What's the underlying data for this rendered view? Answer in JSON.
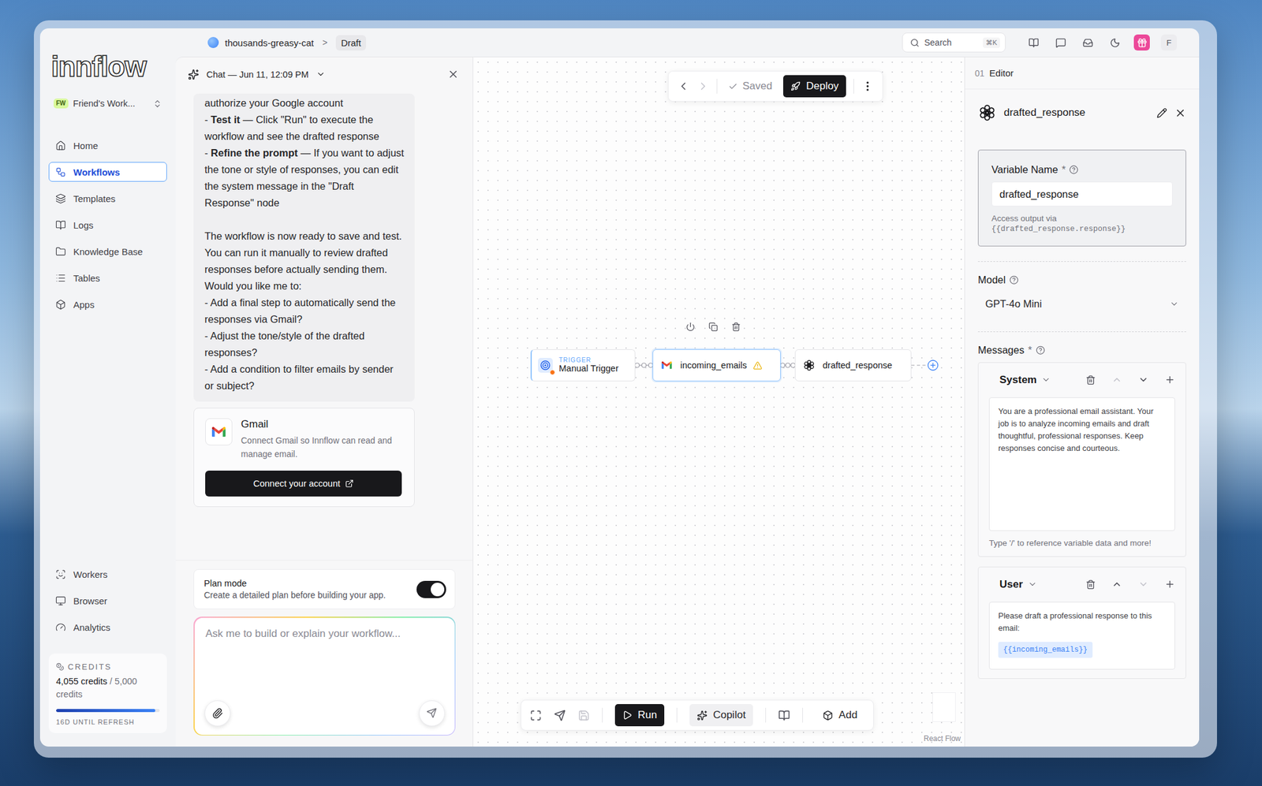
{
  "breadcrumb": {
    "project": "thousands-greasy-cat",
    "separator": ">",
    "page": "Draft"
  },
  "topbar": {
    "search": {
      "placeholder": "Search",
      "shortcut": "⌘K"
    },
    "avatar": "F"
  },
  "sidebar": {
    "logo": "innflow",
    "workspace": {
      "badge": "FW",
      "name": "Friend's Work..."
    },
    "items": [
      {
        "label": "Home",
        "selected": false
      },
      {
        "label": "Workflows",
        "selected": true
      },
      {
        "label": "Templates",
        "selected": false
      },
      {
        "label": "Logs",
        "selected": false
      },
      {
        "label": "Knowledge Base",
        "selected": false
      },
      {
        "label": "Tables",
        "selected": false
      },
      {
        "label": "Apps",
        "selected": false
      }
    ],
    "bottom_items": [
      {
        "label": "Workers",
        "selected": false
      },
      {
        "label": "Browser",
        "selected": false
      },
      {
        "label": "Analytics",
        "selected": false
      }
    ],
    "credits": {
      "title": "CREDITS",
      "amount": "4,055 credits",
      "total": "/ 5,000 credits",
      "level": 0.96,
      "refresh": "16D UNTIL REFRESH"
    }
  },
  "chat": {
    "title": "Chat — Jun 11, 12:09 PM",
    "paragraphs": [
      [
        {
          "prefix": "",
          "bold": "",
          "text": "authorize your Google account"
        },
        {
          "prefix": "- ",
          "bold": "Test it",
          "text": " — Click \"Run\" to execute the workflow and see the drafted response"
        },
        {
          "prefix": "- ",
          "bold": "Refine the prompt",
          "text": " — If you want to adjust the tone or style of responses, you can edit the system message in the \"Draft Response\" node"
        }
      ],
      [
        {
          "prefix": "",
          "bold": "",
          "text": "The workflow is now ready to save and test. You can run it manually to review drafted responses before actually sending them. Would you like me to:"
        },
        {
          "prefix": "- ",
          "bold": "",
          "text": "Add a final step to automatically send the responses via Gmail?"
        },
        {
          "prefix": "- ",
          "bold": "",
          "text": "Adjust the tone/style of the drafted responses?"
        },
        {
          "prefix": "- ",
          "bold": "",
          "text": "Add a condition to filter emails by sender or subject?"
        }
      ]
    ],
    "connect_card": {
      "title": "Gmail",
      "description": "Connect Gmail so Innflow can read and manage email.",
      "button": "Connect your account"
    },
    "plan_mode": {
      "title": "Plan mode",
      "description": "Create a detailed plan before building your app.",
      "on": true
    },
    "input": {
      "placeholder": "Ask me to build or explain your workflow..."
    }
  },
  "canvas": {
    "toolbar": {
      "back_disabled": false,
      "forward_disabled": true,
      "saved": "Saved",
      "deploy": "Deploy"
    },
    "nodes": [
      {
        "kind": "trigger",
        "tag": "TRIGGER",
        "label": "Manual Trigger",
        "selected": false,
        "warning": false
      },
      {
        "kind": "gmail",
        "tag": "",
        "label": "incoming_emails",
        "selected": true,
        "warning": true
      },
      {
        "kind": "openai",
        "tag": "",
        "label": "drafted_response",
        "selected": false,
        "warning": false
      }
    ],
    "bottom_toolbar": {
      "run": "Run",
      "copilot": "Copilot",
      "add": "Add",
      "save_disabled": true
    },
    "attribution": "React Flow"
  },
  "editor": {
    "step": "01",
    "title": "Editor",
    "node": "drafted_response",
    "variable": {
      "label": "Variable Name",
      "required": "*",
      "value": "drafted_response",
      "hint": "Access output via",
      "code": "{{drafted_response.response}}"
    },
    "model": {
      "label": "Model",
      "value": "GPT-4o Mini"
    },
    "messages": {
      "label": "Messages",
      "required": "*",
      "items": [
        {
          "role": "System",
          "text": "You are a professional email assistant. Your job is to analyze incoming emails and draft thoughtful, professional responses. Keep responses concise and courteous.",
          "chip": "",
          "hint": "Type '/' to reference variable data and more!",
          "up_disabled": true,
          "down_disabled": false
        },
        {
          "role": "User",
          "text": "Please draft a professional response to this email:",
          "chip": "{{incoming_emails}}",
          "hint": "",
          "up_disabled": false,
          "down_disabled": true
        }
      ]
    }
  }
}
